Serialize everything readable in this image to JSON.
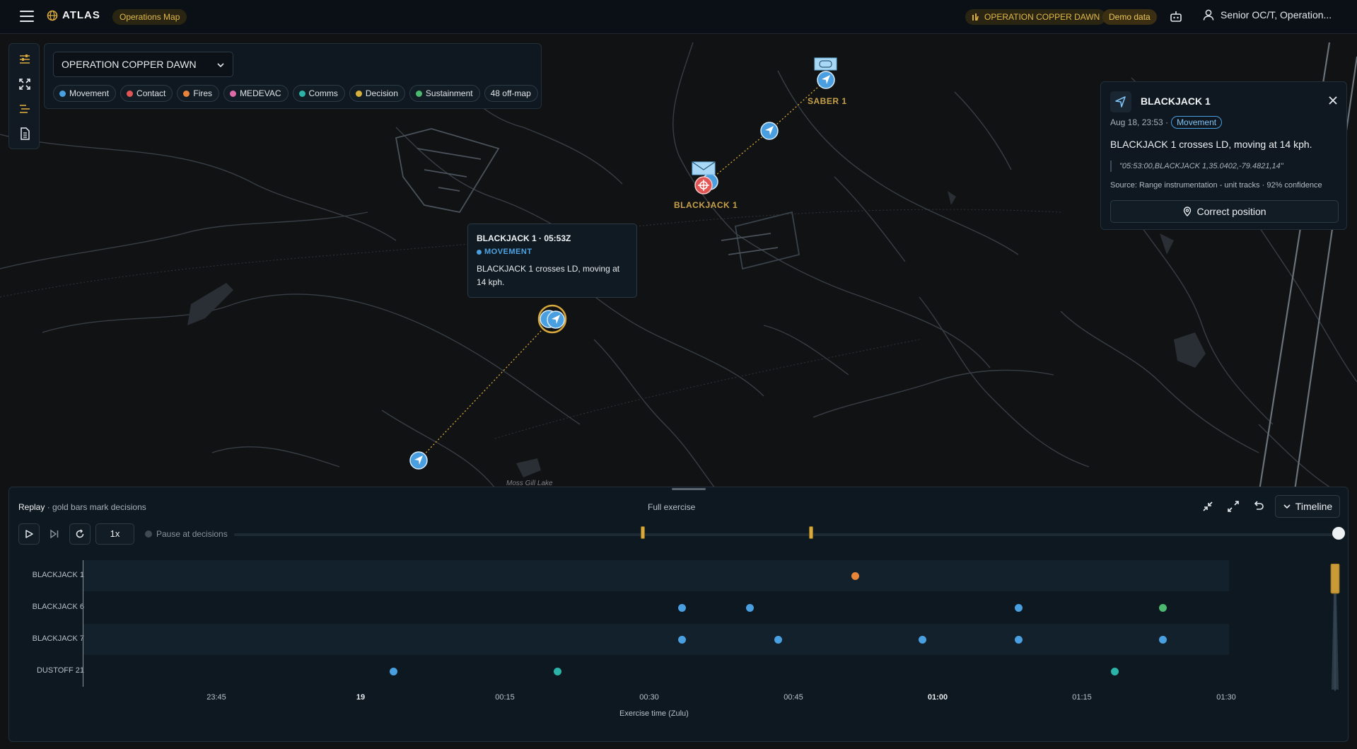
{
  "topbar": {
    "logo_text": "ATLAS",
    "nav_pill": "Operations Map",
    "operation_pill": "OPERATION COPPER DAWN",
    "demo_pill": "Demo data",
    "user_label": "Senior OC/T, Operation..."
  },
  "filters": {
    "operation_select": "OPERATION COPPER DAWN",
    "chips": [
      {
        "label": "Movement",
        "color": "#4a9fe0"
      },
      {
        "label": "Contact",
        "color": "#e25555"
      },
      {
        "label": "Fires",
        "color": "#e8853a"
      },
      {
        "label": "MEDEVAC",
        "color": "#e06aa8"
      },
      {
        "label": "Comms",
        "color": "#2bb3a8"
      },
      {
        "label": "Decision",
        "color": "#d8b03c"
      },
      {
        "label": "Sustainment",
        "color": "#4cb870"
      }
    ],
    "offmap_label": "48 off-map"
  },
  "map": {
    "labels": {
      "saber": "SABER 1",
      "blackjack": "BLACKJACK 1",
      "lake": "Moss Gill Lake"
    },
    "popup": {
      "title": "BLACKJACK 1 · 05:53Z",
      "type": "MOVEMENT",
      "description": "BLACKJACK 1 crosses LD, moving at 14 kph."
    }
  },
  "detail": {
    "title": "BLACKJACK 1",
    "time": "Aug 18, 23:53 ·",
    "badge": "Movement",
    "description": "BLACKJACK 1 crosses LD, moving at 14 kph.",
    "raw": "\"05:53:00,BLACKJACK 1,35.0402,-79.4821,14\"",
    "source": "Source: Range instrumentation - unit tracks · 92% confidence",
    "action": "Correct position"
  },
  "replay": {
    "title": "Replay",
    "subtitle": "· gold bars mark decisions",
    "range_label": "Full exercise",
    "timeline_button": "Timeline",
    "speed": "1x",
    "pause_label": "Pause at decisions",
    "lanes": [
      {
        "label": "BLACKJACK 1",
        "events": [
          {
            "t": "00:52",
            "color": "#e8853a"
          }
        ]
      },
      {
        "label": "BLACKJACK 6",
        "events": [
          {
            "t": "00:34",
            "color": "#4a9fe0"
          },
          {
            "t": "00:41",
            "color": "#4a9fe0"
          },
          {
            "t": "01:09",
            "color": "#4a9fe0"
          },
          {
            "t": "01:24",
            "color": "#4cb870"
          }
        ]
      },
      {
        "label": "BLACKJACK 7",
        "events": [
          {
            "t": "00:34",
            "color": "#4a9fe0"
          },
          {
            "t": "00:44",
            "color": "#4a9fe0"
          },
          {
            "t": "00:59",
            "color": "#4a9fe0"
          },
          {
            "t": "01:09",
            "color": "#4a9fe0"
          },
          {
            "t": "01:24",
            "color": "#4a9fe0"
          }
        ]
      },
      {
        "label": "DUSTOFF 21",
        "events": [
          {
            "t": "00:04",
            "color": "#4a9fe0"
          },
          {
            "t": "00:21",
            "color": "#2bb3a8"
          },
          {
            "t": "01:19",
            "color": "#2bb3a8"
          }
        ]
      }
    ],
    "ticks": [
      "23:45",
      "19",
      "00:15",
      "00:30",
      "00:45",
      "01:00",
      "01:15",
      "01:30"
    ],
    "bold_ticks": [
      "19",
      "01:00"
    ],
    "axis_title": "Exercise time (Zulu)"
  }
}
